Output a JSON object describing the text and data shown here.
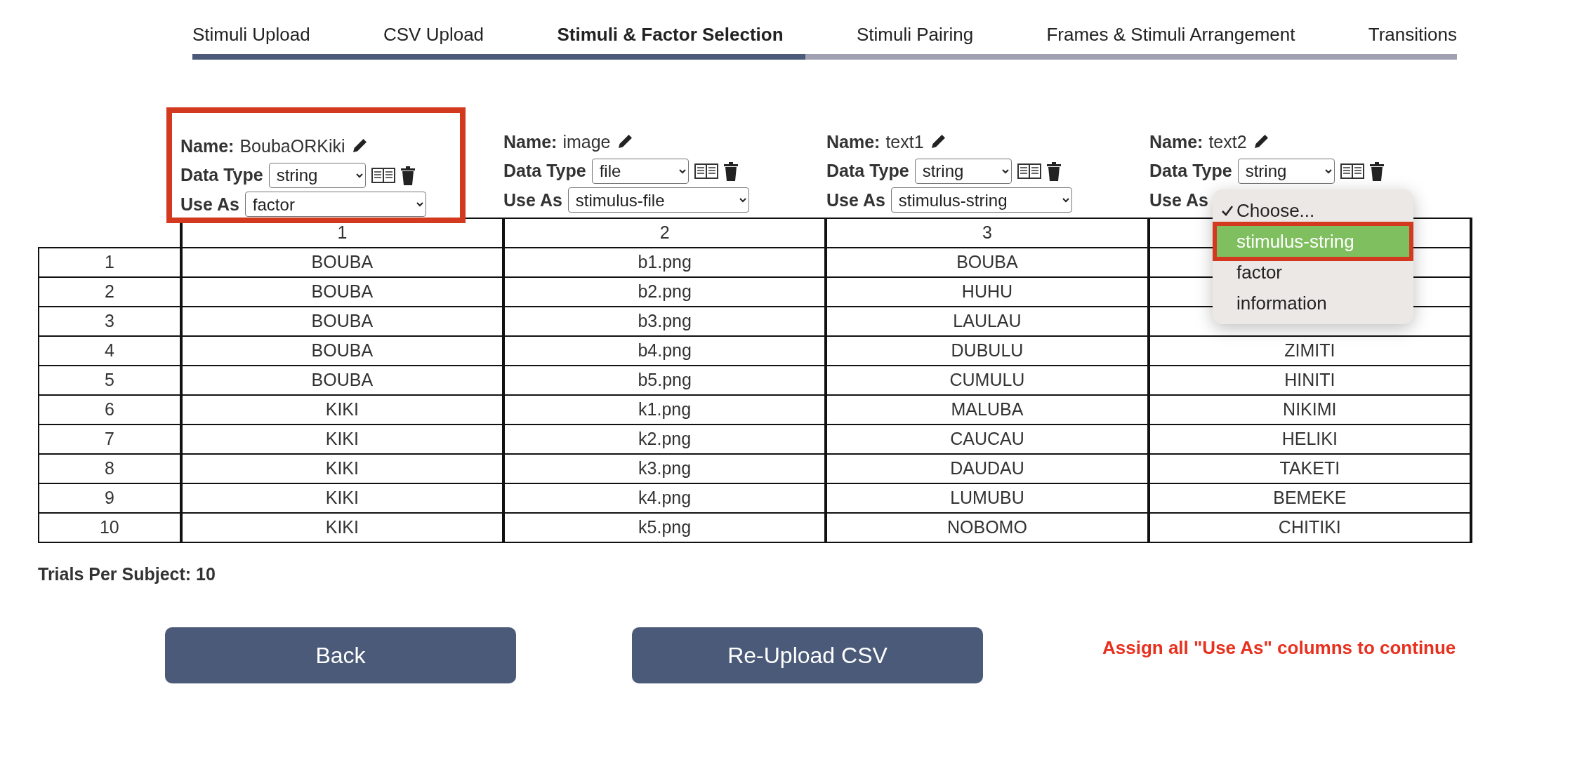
{
  "tabs": [
    {
      "label": "Stimuli Upload",
      "selected": false
    },
    {
      "label": "CSV Upload",
      "selected": false
    },
    {
      "label": "Stimuli & Factor Selection",
      "selected": true
    },
    {
      "label": "Stimuli Pairing",
      "selected": false
    },
    {
      "label": "Frames & Stimuli Arrangement",
      "selected": false
    },
    {
      "label": "Transitions",
      "selected": false
    }
  ],
  "progress": {
    "level": 0.485
  },
  "columns": [
    {
      "name_label": "Name:",
      "name": "BoubaORKiki",
      "data_type_label": "Data Type",
      "data_type": "string",
      "use_as_label": "Use As",
      "use_as": "factor",
      "number": "1",
      "highlighted": true
    },
    {
      "name_label": "Name:",
      "name": "image",
      "data_type_label": "Data Type",
      "data_type": "file",
      "use_as_label": "Use As",
      "use_as": "stimulus-file",
      "number": "2",
      "highlighted": false
    },
    {
      "name_label": "Name:",
      "name": "text1",
      "data_type_label": "Data Type",
      "data_type": "string",
      "use_as_label": "Use As",
      "use_as": "stimulus-string",
      "number": "3",
      "highlighted": false
    },
    {
      "name_label": "Name:",
      "name": "text2",
      "data_type_label": "Data Type",
      "data_type": "string",
      "use_as_label": "Use As",
      "highlighted": false
    }
  ],
  "use_as_menu": {
    "items": [
      {
        "label": "Choose...",
        "checked": true,
        "selected": false
      },
      {
        "label": "stimulus-string",
        "checked": false,
        "selected": true
      },
      {
        "label": "factor",
        "checked": false,
        "selected": false
      },
      {
        "label": "information",
        "checked": false,
        "selected": false
      }
    ]
  },
  "rows": [
    {
      "number": "1",
      "cells": [
        "BOUBA",
        "b1.png",
        "BOUBA"
      ]
    },
    {
      "number": "2",
      "cells": [
        "BOUBA",
        "b2.png",
        "HUHU"
      ]
    },
    {
      "number": "3",
      "cells": [
        "BOUBA",
        "b3.png",
        "LAULAU"
      ]
    },
    {
      "number": "4",
      "cells": [
        "BOUBA",
        "b4.png",
        "DUBULU",
        "ZIMITI"
      ]
    },
    {
      "number": "5",
      "cells": [
        "BOUBA",
        "b5.png",
        "CUMULU",
        "HINITI"
      ]
    },
    {
      "number": "6",
      "cells": [
        "KIKI",
        "k1.png",
        "MALUBA",
        "NIKIMI"
      ]
    },
    {
      "number": "7",
      "cells": [
        "KIKI",
        "k2.png",
        "CAUCAU",
        "HELIKI"
      ]
    },
    {
      "number": "8",
      "cells": [
        "KIKI",
        "k3.png",
        "DAUDAU",
        "TAKETI"
      ]
    },
    {
      "number": "9",
      "cells": [
        "KIKI",
        "k4.png",
        "LUMUBU",
        "BEMEKE"
      ]
    },
    {
      "number": "10",
      "cells": [
        "KIKI",
        "k5.png",
        "NOBOMO",
        "CHITIKI"
      ]
    }
  ],
  "trials_per_subject": "Trials Per Subject: 10",
  "buttons": [
    "Back",
    "Re-Upload CSV"
  ],
  "warning": "Assign all \"Use As\" columns to continue"
}
